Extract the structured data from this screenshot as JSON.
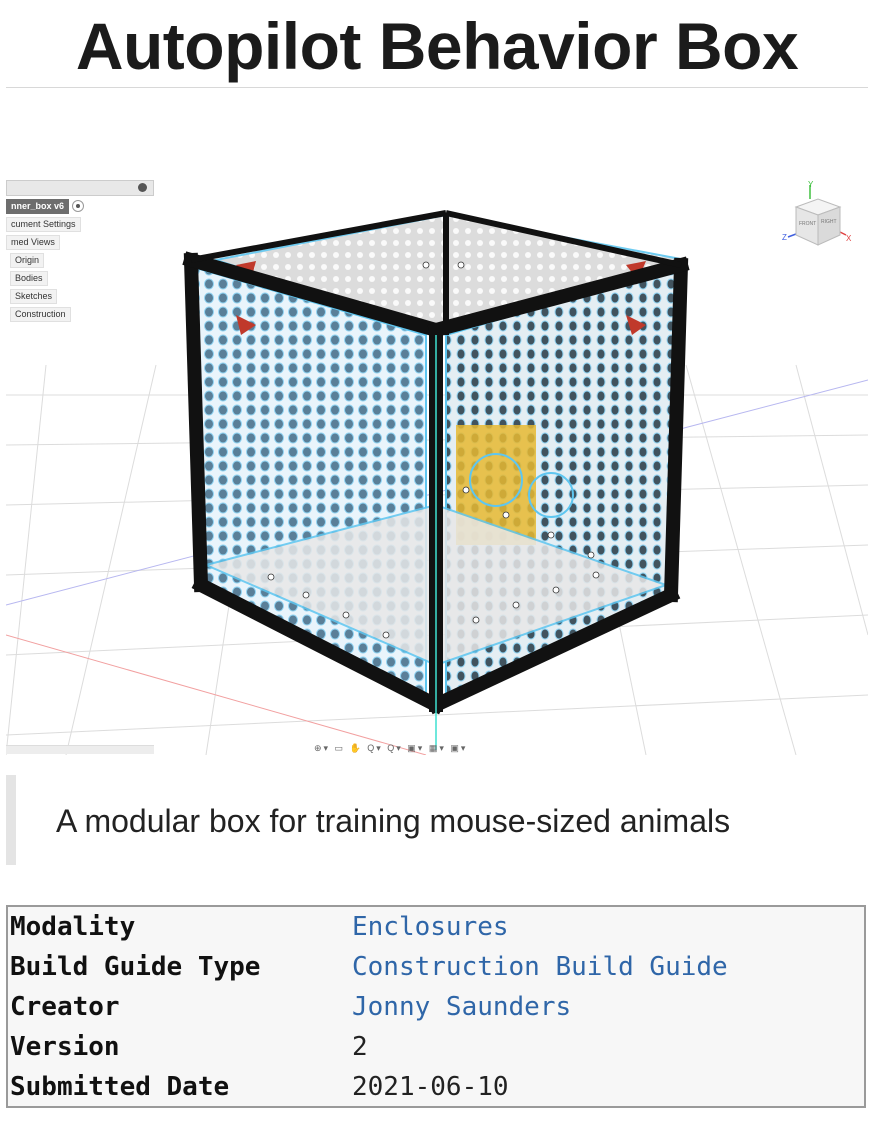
{
  "page": {
    "title": "Autopilot Behavior Box",
    "tagline": "A modular box for training mouse-sized animals"
  },
  "cad_view": {
    "browser": {
      "items": [
        {
          "label": "nner_box v6",
          "root": true
        },
        {
          "label": "cument Settings"
        },
        {
          "label": "med Views"
        },
        {
          "label": "Origin"
        },
        {
          "label": "Bodies"
        },
        {
          "label": "Sketches"
        },
        {
          "label": "Construction"
        }
      ]
    },
    "view_cube": {
      "front_label": "FRONT",
      "right_label": "RIGHT",
      "axis_y": "Y",
      "axis_z": "Z",
      "axis_x": "X",
      "colors": {
        "x": "#e04040",
        "y": "#40c040",
        "z": "#4060e0"
      }
    },
    "nav_toolbar": "⊕▾ ▭ ✋ Q▾ Q▾ ▣▾ ▦▾ ▣▾"
  },
  "metadata": {
    "rows": [
      {
        "key": "Modality",
        "value": "Enclosures",
        "link": true
      },
      {
        "key": "Build Guide Type",
        "value": "Construction Build Guide",
        "link": true
      },
      {
        "key": "Creator",
        "value": "Jonny Saunders",
        "link": true
      },
      {
        "key": "Version",
        "value": "2",
        "link": false
      },
      {
        "key": "Submitted Date",
        "value": "2021-06-10",
        "link": false
      }
    ]
  },
  "colors": {
    "link": "#2f66a8",
    "frame": "#111111",
    "panel_edge": "#5ec6f0",
    "accent_red": "#c0392b",
    "accent_yellow": "#e8b830"
  }
}
